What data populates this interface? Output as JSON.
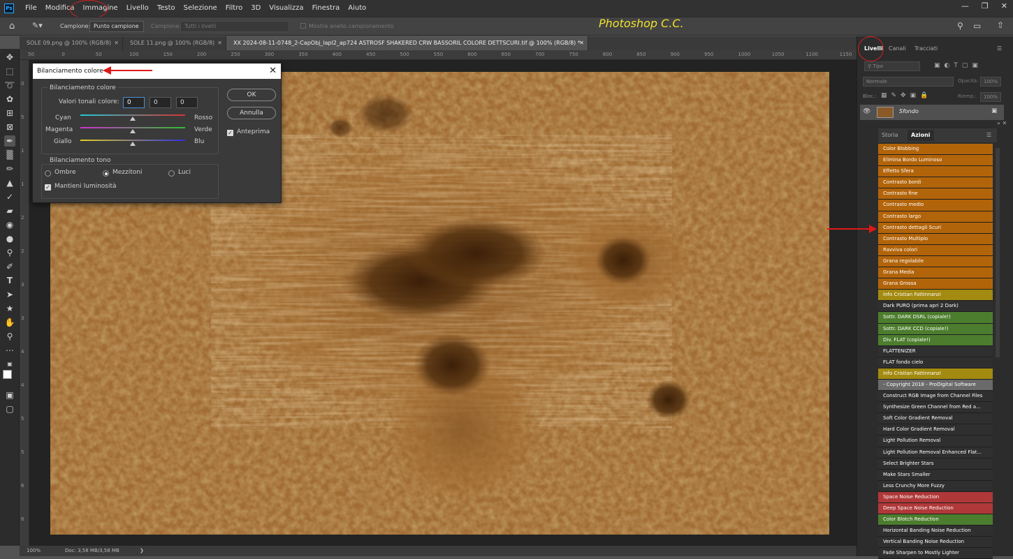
{
  "app": {
    "watermark": "Photoshop C.C.",
    "logo": "Ps"
  },
  "menu": [
    "File",
    "Modifica",
    "Immagine",
    "Livello",
    "Testo",
    "Selezione",
    "Filtro",
    "3D",
    "Visualizza",
    "Finestra",
    "Aiuto"
  ],
  "options_bar": {
    "sample_label": "Campione:",
    "sample_value": "Punto campione",
    "sample2_label": "Campione:",
    "sample2_value": "Tutti i livelli",
    "ring_label": "Mostra anello campionamento"
  },
  "tabs": [
    {
      "label": "SOLE 09.png @ 100% (RGB/8)"
    },
    {
      "label": "SOLE 11.png @ 100% (RGB/8)"
    },
    {
      "label": "XX 2024-08-11-0748_2-CapObj_lapl2_ap724 ASTROSF SHAKERED CRW BASSORIL COLORE DETTSCURI.tif @ 100% (RGB/8) *"
    }
  ],
  "ruler_top": [
    "50",
    "0",
    "50",
    "100",
    "150",
    "200",
    "250",
    "300",
    "350",
    "400",
    "450",
    "500",
    "550",
    "600",
    "650",
    "700",
    "750",
    "800",
    "850",
    "900",
    "950",
    "1000",
    "1050",
    "1100",
    "1150"
  ],
  "ruler_left": [
    "0",
    "5",
    "1",
    "1",
    "2",
    "2",
    "3",
    "3",
    "4",
    "4",
    "5",
    "5",
    "6",
    "6"
  ],
  "status": {
    "zoom": "100%",
    "doc": "Doc: 3,58 MB/3,58 MB"
  },
  "dialog": {
    "title": "Bilanciamento colore",
    "group1_title": "Bilanciamento colore",
    "values_label": "Valori tonali colore:",
    "values": [
      "0",
      "0",
      "0"
    ],
    "sliders": [
      {
        "left": "Cyan",
        "right": "Rosso",
        "value": 0
      },
      {
        "left": "Magenta",
        "right": "Verde",
        "value": 0
      },
      {
        "left": "Giallo",
        "right": "Blu",
        "value": 0
      }
    ],
    "group2_title": "Bilanciamento tono",
    "tone_options": [
      "Ombre",
      "Mezzitoni",
      "Luci"
    ],
    "tone_selected": "Mezzitoni",
    "preserve_label": "Mantieni luminosità",
    "ok_label": "OK",
    "cancel_label": "Annulla",
    "preview_label": "Anteprima"
  },
  "layers_panel": {
    "tabs": [
      "Livelli",
      "Canali",
      "Tracciati"
    ],
    "filter_placeholder": "Tipo",
    "blend_mode": "Normale",
    "opacity_label": "Opacità:",
    "opacity_value": "100%",
    "lock_label": "Bloc.:",
    "fill_label": "Riemp.:",
    "fill_value": "100%",
    "layer_name": "Sfondo"
  },
  "actions_panel": {
    "tabs": [
      "Storia",
      "Azioni"
    ],
    "items": [
      {
        "label": "Color Blobbing",
        "color": "#b2640a"
      },
      {
        "label": "Elimina Bordo Luminoso",
        "color": "#b2640a"
      },
      {
        "label": "Effetto Sfera",
        "color": "#b2640a"
      },
      {
        "label": "Contrasto bordi",
        "color": "#b2640a"
      },
      {
        "label": "Contrasto fine",
        "color": "#b2640a"
      },
      {
        "label": "Contrasto medio",
        "color": "#b2640a"
      },
      {
        "label": "Contrasto largo",
        "color": "#b2640a"
      },
      {
        "label": "Contrasto dettagli Scuri",
        "color": "#b2640a"
      },
      {
        "label": "Contrasto Multiplo",
        "color": "#b2640a"
      },
      {
        "label": "Ravviva colori",
        "color": "#b2640a"
      },
      {
        "label": "Grana regolabile",
        "color": "#b2640a"
      },
      {
        "label": "Grana Media",
        "color": "#b2640a"
      },
      {
        "label": "Grana Grossa",
        "color": "#b2640a"
      },
      {
        "label": "Info Cristian Fattinnanzi",
        "color": "#a38a10"
      },
      {
        "label": "Dark PURO (prima apri 2 Dark)",
        "color": "#2f2f2f"
      },
      {
        "label": "Sottr. DARK DSRL (copiale!)",
        "color": "#4c7d2e"
      },
      {
        "label": "Sottr. DARK CCD (copiale!)",
        "color": "#4c7d2e"
      },
      {
        "label": "Div. FLAT (copiale!)",
        "color": "#4c7d2e"
      },
      {
        "label": "FLATTENIZER",
        "color": "#2f2f2f"
      },
      {
        "label": "FLAT fondo cielo",
        "color": "#2f2f2f"
      },
      {
        "label": "Info Cristian Fattinnanzi",
        "color": "#a38a10"
      },
      {
        "label": "- Copyright 2018 - ProDigital Software",
        "color": "#6a6a6a"
      },
      {
        "label": "Construct RGB Image from Channel Files",
        "color": "#2f2f2f"
      },
      {
        "label": "Synthesize Green Channel from Red a...",
        "color": "#2f2f2f"
      },
      {
        "label": "Soft Color Gradient Removal",
        "color": "#2f2f2f"
      },
      {
        "label": "Hard Color Gradient Removal",
        "color": "#2f2f2f"
      },
      {
        "label": "Light Pollution Removal",
        "color": "#2f2f2f"
      },
      {
        "label": "Light Pollution Removal Enhanced Flat...",
        "color": "#2f2f2f"
      },
      {
        "label": "Select Brighter Stars",
        "color": "#2f2f2f"
      },
      {
        "label": "Make Stars Smaller",
        "color": "#2f2f2f"
      },
      {
        "label": "Less Crunchy More Fuzzy",
        "color": "#2f2f2f"
      },
      {
        "label": "Space Noise Reduction",
        "color": "#b03838"
      },
      {
        "label": "Deep Space Noise Reduction",
        "color": "#b03838"
      },
      {
        "label": "Color Blotch Reduction",
        "color": "#4c7d2e"
      },
      {
        "label": "Horizontal Banding Noise Reduction",
        "color": "#2f2f2f"
      },
      {
        "label": "Vertical Banding Noise Reduction",
        "color": "#2f2f2f"
      },
      {
        "label": "Fade Sharpen to Mostly Lighter",
        "color": "#2f2f2f"
      }
    ]
  },
  "annotation_color": "#d81e1e"
}
